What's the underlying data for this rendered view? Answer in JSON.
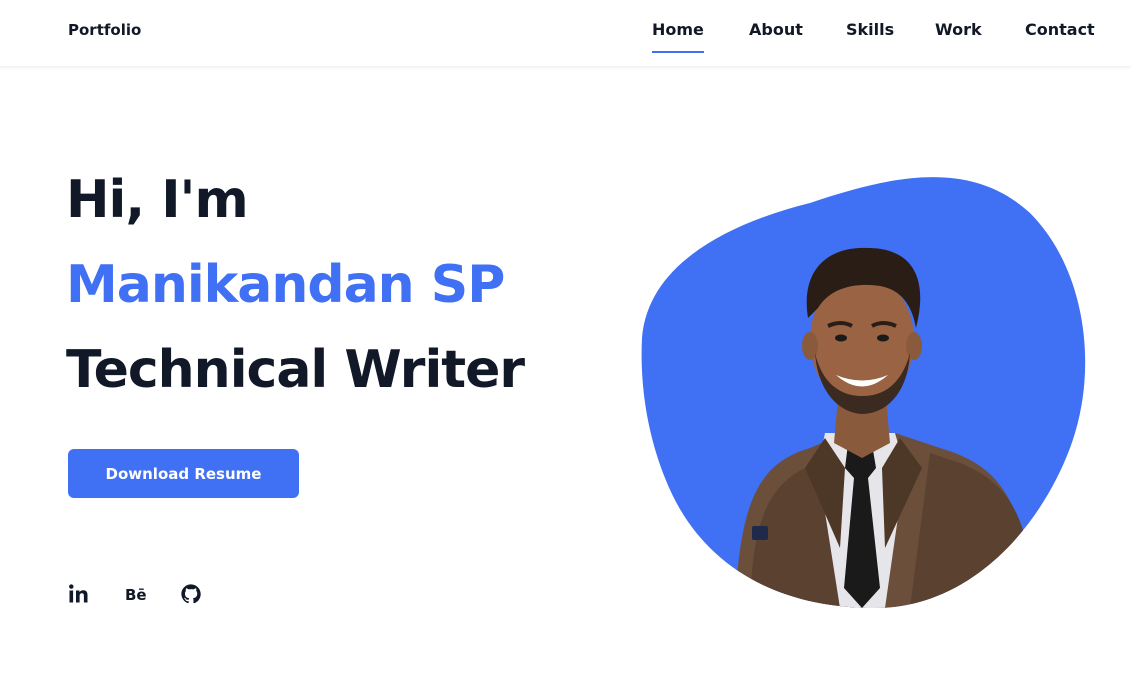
{
  "header": {
    "logo": "Portfolio",
    "nav": [
      {
        "label": "Home",
        "active": true
      },
      {
        "label": "About",
        "active": false
      },
      {
        "label": "Skills",
        "active": false
      },
      {
        "label": "Work",
        "active": false
      },
      {
        "label": "Contact",
        "active": false
      }
    ]
  },
  "hero": {
    "greeting": "Hi, I'm",
    "name": "Manikandan SP",
    "role": "Technical Writer",
    "button_label": "Download Resume"
  },
  "social": [
    {
      "icon": "linkedin-icon",
      "label": "in"
    },
    {
      "icon": "behance-icon",
      "label": "Bē"
    },
    {
      "icon": "github-icon"
    }
  ],
  "colors": {
    "accent": "#4070f4",
    "text": "#111827",
    "background": "#ffffff"
  }
}
